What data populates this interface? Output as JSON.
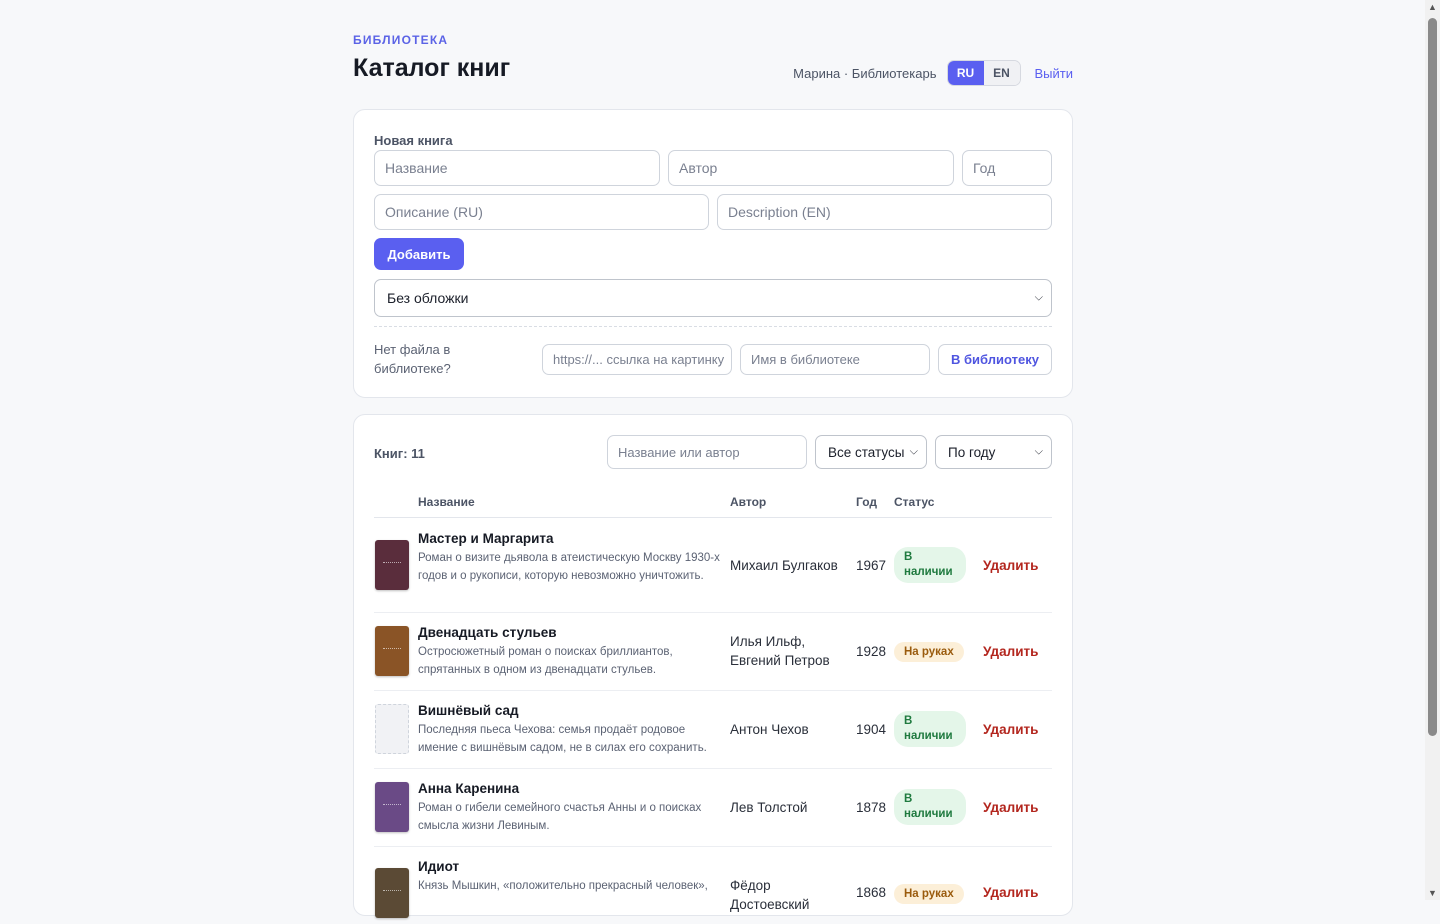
{
  "header": {
    "kicker": "БИБЛИОТЕКА",
    "title": "Каталог книг",
    "user": "Марина · Библиотекарь",
    "lang_ru": "RU",
    "lang_en": "EN",
    "logout": "Выйти"
  },
  "new_book": {
    "section_label": "Новая книга",
    "title_placeholder": "Название",
    "author_placeholder": "Автор",
    "year_placeholder": "Год",
    "desc_ru_placeholder": "Описание (RU)",
    "desc_en_placeholder": "Description (EN)",
    "add_button": "Добавить",
    "cover_select": "Без обложки",
    "no_file_text": "Нет файла в библиотеке?",
    "url_placeholder": "https://... ссылка на картинку",
    "name_placeholder": "Имя в библиотеке",
    "to_library_button": "В библиотеку"
  },
  "list": {
    "count": "Книг: 11",
    "search_placeholder": "Название или автор",
    "status_filter": "Все статусы",
    "sort": "По году",
    "columns": {
      "title": "Название",
      "author": "Автор",
      "year": "Год",
      "status": "Статус"
    },
    "delete_label": "Удалить",
    "books": [
      {
        "title": "Мастер и Маргарита",
        "desc": "Роман о визите дьявола в атеистическую Москву 1930-х годов и о рукописи, которую невозможно уничтожить.",
        "author": "Михаил Булгаков",
        "year": "1967",
        "status": "В наличии",
        "status_kind": "available",
        "cover_color": "#5a2d3c"
      },
      {
        "title": "Двенадцать стульев",
        "desc": "Остросюжетный роман о поисках бриллиантов, спрятанных в одном из двенадцати стульев.",
        "author": "Илья Ильф, Евгений Петров",
        "year": "1928",
        "status": "На руках",
        "status_kind": "borrowed",
        "cover_color": "#8a5426"
      },
      {
        "title": "Вишнёвый сад",
        "desc": "Последняя пьеса Чехова: семья продаёт родовое имение с вишнёвым садом, не в силах его сохранить.",
        "author": "Антон Чехов",
        "year": "1904",
        "status": "В наличии",
        "status_kind": "available",
        "cover_color": ""
      },
      {
        "title": "Анна Каренина",
        "desc": "Роман о гибели семейного счастья Анны и о поисках смысла жизни Левиным.",
        "author": "Лев Толстой",
        "year": "1878",
        "status": "В наличии",
        "status_kind": "available",
        "cover_color": "#6a4a86"
      },
      {
        "title": "Идиот",
        "desc": "Князь Мышкин, «положительно прекрасный человек»,",
        "author": "Фёдор Достоевский",
        "year": "1868",
        "status": "На руках",
        "status_kind": "borrowed",
        "cover_color": "#5b4a35"
      }
    ]
  }
}
